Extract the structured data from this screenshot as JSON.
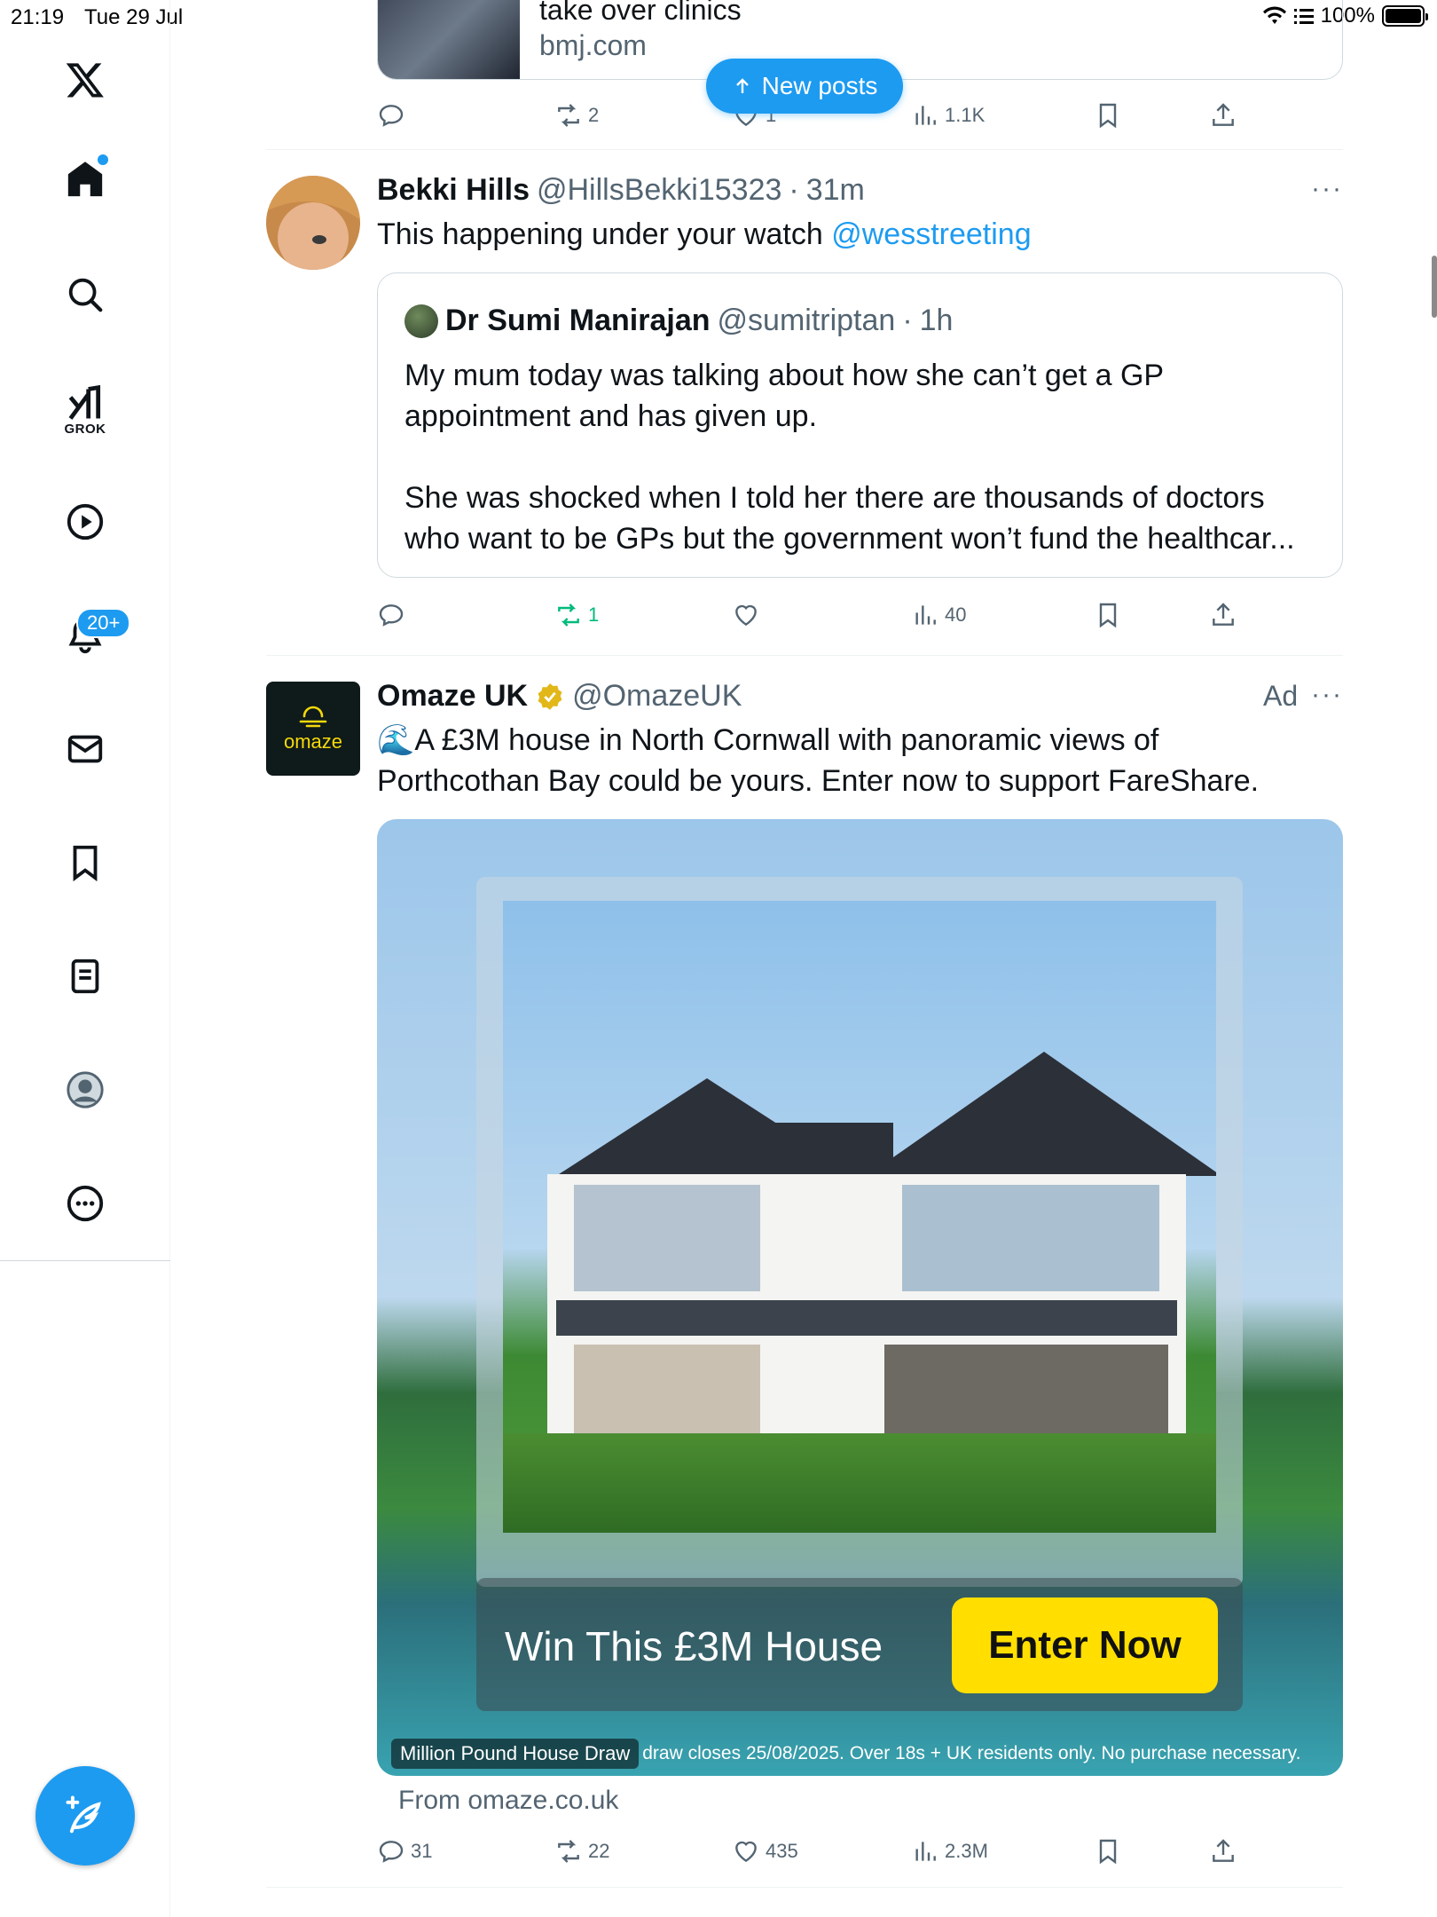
{
  "status_bar": {
    "time": "21:19",
    "date": "Tue 29 Jul",
    "battery": "100%"
  },
  "nav": {
    "grok_label": "GROK",
    "notifications_badge": "20+"
  },
  "new_posts_label": "New posts",
  "prev_post": {
    "link_title": "take over clinics",
    "link_domain": "bmj.com",
    "stats": {
      "replies": "",
      "reposts": "2",
      "likes": "1",
      "views": "1.1K"
    }
  },
  "post1": {
    "name": "Bekki Hills",
    "handle": "@HillsBekki15323",
    "dot": "·",
    "time": "31m",
    "text": "This happening under your watch ",
    "mention": "@wesstreeting",
    "quote": {
      "name": "Dr Sumi Manirajan",
      "handle": "@sumitriptan",
      "dot": "·",
      "time": "1h",
      "text_line1": "My mum today was talking about how she can’t get a GP appointment and has given up.",
      "text_line2": "She was shocked when I told her there are thousands of doctors who want to be GPs but the government won’t fund the healthcar..."
    },
    "stats": {
      "replies": "",
      "reposts": "1",
      "likes": "",
      "views": "40"
    }
  },
  "post2": {
    "name": "Omaze UK",
    "handle": "@OmazeUK",
    "ad_label": "Ad",
    "avatar_text": "omaze",
    "text_line1": "🌊A £3M house in North Cornwall with panoramic views of",
    "text_line2": "Porthcothan Bay could be yours. Enter now to support FareShare.",
    "banner_text": "Win This £3M House",
    "cta": "Enter Now",
    "image_badge": "Million Pound House Draw",
    "disclaimer": "draw closes 25/08/2025. Over 18s + UK residents only. No purchase necessary.",
    "from": "From omaze.co.uk",
    "stats": {
      "replies": "31",
      "reposts": "22",
      "likes": "435",
      "views": "2.3M"
    }
  },
  "colors": {
    "accent": "#1d9bf0",
    "repost_active": "#00ba7c",
    "cta_yellow": "#ffde00",
    "verified_gold": "#e2b719"
  }
}
